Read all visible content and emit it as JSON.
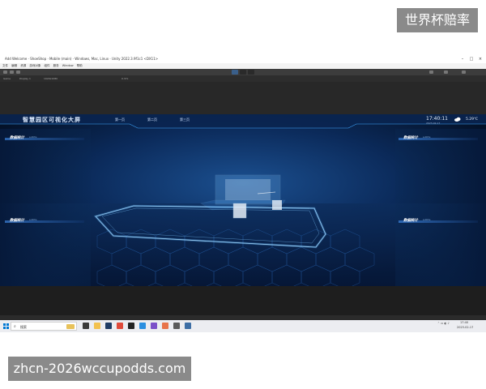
{
  "watermark": {
    "top_text": "世界杯赔率",
    "bottom_text": "zhcn-2026wccupodds.com"
  },
  "window": {
    "title": "Add Welcome · ShoeShop · Mobile (main) · Windows, Mac, Linux · Unity 2022.3.9f1c1 <DX11>",
    "controls": [
      "–",
      "□",
      "×"
    ]
  },
  "menubar": {
    "items": [
      "文件",
      "编辑",
      "资源",
      "游戏对象",
      "组件",
      "服务",
      "Window",
      "帮助"
    ]
  },
  "panelbar": {
    "game_tab": "Game",
    "display": "Display 1",
    "resolution": "1920x1080",
    "scale": "0.37x"
  },
  "game": {
    "main_title": "智慧园区可视化大屏",
    "tabs": [
      "第一页",
      "第二页",
      "第三页"
    ],
    "clock": "17:40:11",
    "date": "2023-02-17",
    "temperature": "5.29℃",
    "panels": [
      {
        "title": "数据统计",
        "subtitle": "subtitle"
      },
      {
        "title": "数据统计",
        "subtitle": "subtitle"
      },
      {
        "title": "数据统计",
        "subtitle": "subtitle"
      },
      {
        "title": "数据统计",
        "subtitle": "subtitle"
      }
    ]
  },
  "taskbar": {
    "search_placeholder": "搜索",
    "time": "17:40",
    "date": "2023-02-17",
    "apps": [
      "file-explorer-icon",
      "terminal-icon",
      "chrome-icon",
      "unity-icon",
      "vscode-icon",
      "visual-studio-icon",
      "app-icon"
    ],
    "colors": {
      "accent": "#0078d4"
    }
  },
  "colors": {
    "game_background": "#071a3a",
    "glow_blue": "#3fa8ff",
    "editor_dark": "#1e1e1e"
  }
}
